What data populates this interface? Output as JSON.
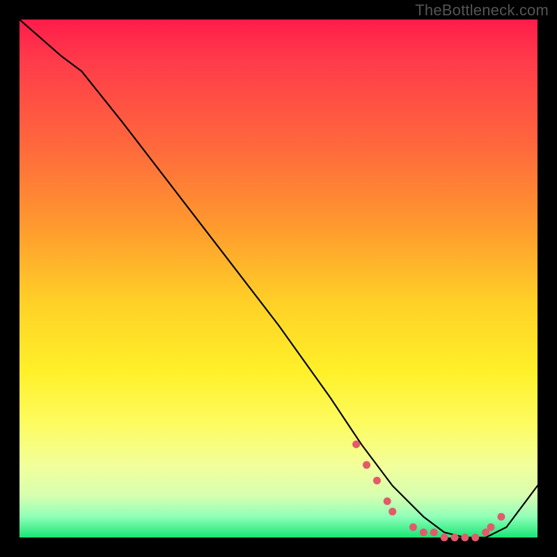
{
  "watermark": "TheBottleneck.com",
  "chart_data": {
    "type": "line",
    "title": "",
    "xlabel": "",
    "ylabel": "",
    "xlim": [
      0,
      100
    ],
    "ylim": [
      0,
      100
    ],
    "series": [
      {
        "name": "curve",
        "x": [
          0,
          8,
          12,
          20,
          30,
          40,
          50,
          60,
          66,
          72,
          78,
          82,
          86,
          90,
          94,
          100
        ],
        "values": [
          100,
          93,
          90,
          80,
          67,
          54,
          41,
          27,
          18,
          10,
          4,
          1,
          0,
          0,
          2,
          10
        ]
      }
    ],
    "markers": {
      "name": "dots",
      "color": "#e35a6a",
      "x": [
        65,
        67,
        69,
        71,
        72,
        76,
        78,
        80,
        82,
        84,
        86,
        88,
        90,
        91,
        93
      ],
      "values": [
        18,
        14,
        11,
        7,
        5,
        2,
        1,
        1,
        0,
        0,
        0,
        0,
        1,
        2,
        4
      ]
    },
    "gradient_stops": [
      {
        "pos": 0,
        "color": "#ff1c4a"
      },
      {
        "pos": 25,
        "color": "#ff6a3c"
      },
      {
        "pos": 55,
        "color": "#ffd227"
      },
      {
        "pos": 78,
        "color": "#fdfc60"
      },
      {
        "pos": 96,
        "color": "#8fffb8"
      },
      {
        "pos": 100,
        "color": "#18e676"
      }
    ]
  }
}
